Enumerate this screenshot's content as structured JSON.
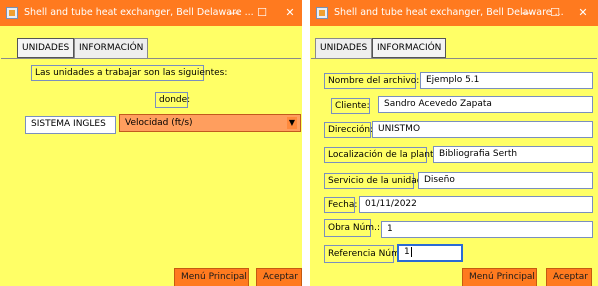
{
  "left_window": {
    "title": "Shell and tube heat exchanger, Bell Delaware ...",
    "controls": {
      "minimize": "—",
      "maximize": "☐",
      "close": "✕"
    },
    "tabs": [
      {
        "label": "UNIDADES",
        "selected": true
      },
      {
        "label": "INFORMACIÓN",
        "selected": false
      }
    ],
    "units_intro": "Las unidades a trabajar son las siguientes:",
    "donde_label": "donde:",
    "unit_system_value": "SISTEMA INGLES",
    "unit_select": {
      "value": "Velocidad (ft/s)",
      "arrow": "▼"
    },
    "menu_button": "Menú Principal",
    "accept_button": "Aceptar"
  },
  "right_window": {
    "title": "Shell and tube heat exchanger, Bell Delaware ...",
    "controls": {
      "minimize": "—",
      "maximize": "☐",
      "close": "✕"
    },
    "tabs": [
      {
        "label": "UNIDADES",
        "selected": false
      },
      {
        "label": "INFORMACIÓN",
        "selected": true
      }
    ],
    "form": {
      "file_name": {
        "label": "Nombre del archivo:",
        "value": "Ejemplo 5.1"
      },
      "client": {
        "label": "Cliente:",
        "value": "Sandro Acevedo Zapata"
      },
      "address": {
        "label": "Dirección:",
        "value": "UNISTMO"
      },
      "plant_location": {
        "label": "Localización de la planta:",
        "value": "Bibliografia Serth"
      },
      "unit_service": {
        "label": "Servicio de la unidad:",
        "value": "Diseño"
      },
      "date": {
        "label": "Fecha:",
        "value": "01/11/2022"
      },
      "work_number": {
        "label": "Obra Núm.:",
        "value": "1"
      },
      "reference_number": {
        "label": "Referencia Núm.:",
        "value": "1"
      }
    },
    "menu_button": "Menú Principal",
    "accept_button": "Aceptar"
  },
  "colors": {
    "titlebar": "#ff7a1f",
    "panel_background": "#ffff66",
    "button": "#ff7a1f",
    "combo": "#ff9e5e",
    "focus_border": "#2a6bd6"
  }
}
